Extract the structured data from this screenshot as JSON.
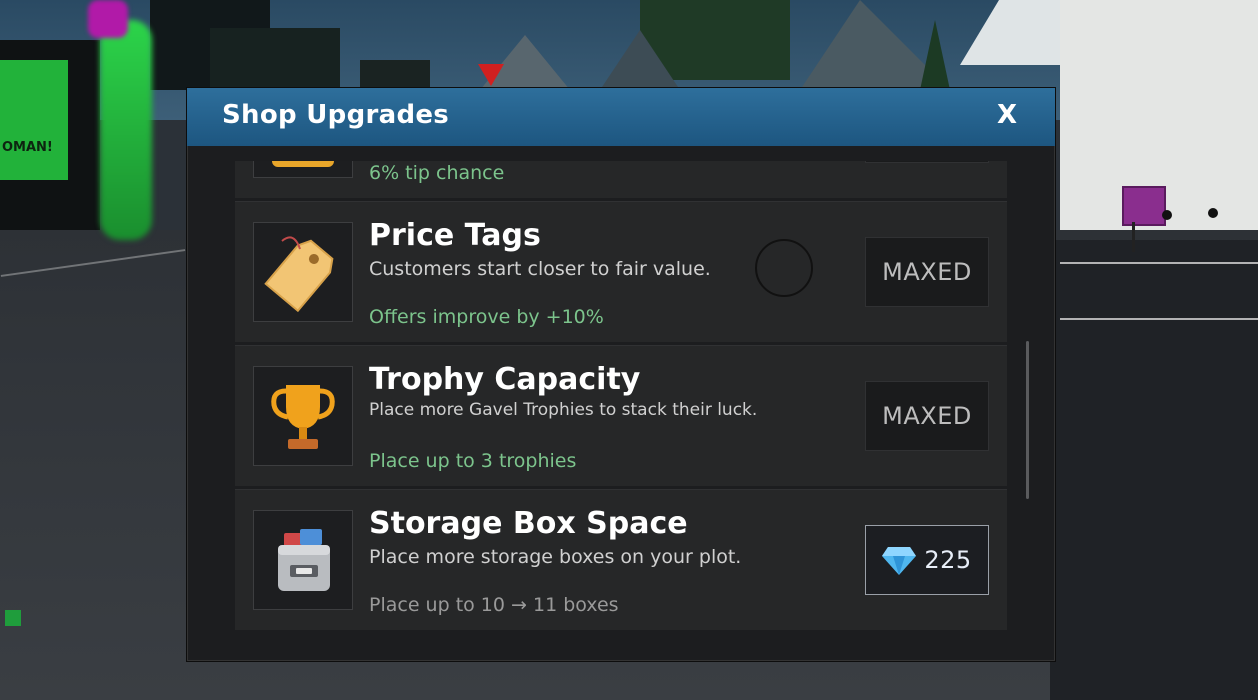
{
  "modal": {
    "title": "Shop Upgrades",
    "close_label": "X"
  },
  "upgrades": [
    {
      "title": "",
      "description": "",
      "effect": "6% tip chance",
      "button": "",
      "icon": "box-icon"
    },
    {
      "title": "Price Tags",
      "description": "Customers start closer to fair value.",
      "effect": "Offers improve by +10%",
      "button": "MAXED",
      "icon": "price-tag-icon"
    },
    {
      "title": "Trophy Capacity",
      "description": "Place more Gavel Trophies to stack their luck.",
      "effect": "Place up to 3 trophies",
      "button": "MAXED",
      "icon": "trophy-icon"
    },
    {
      "title": "Storage Box Space",
      "description": "Place more storage boxes on your plot.",
      "effect": "Place up to 10 → 11 boxes",
      "button": "225",
      "icon": "storage-box-icon",
      "currency_icon": "diamond-icon"
    }
  ],
  "world": {
    "sign_text": "OMAN!"
  },
  "colors": {
    "header": "#2e6f9c",
    "effect_text": "#7cc48c",
    "panel": "#1c1d1f"
  }
}
